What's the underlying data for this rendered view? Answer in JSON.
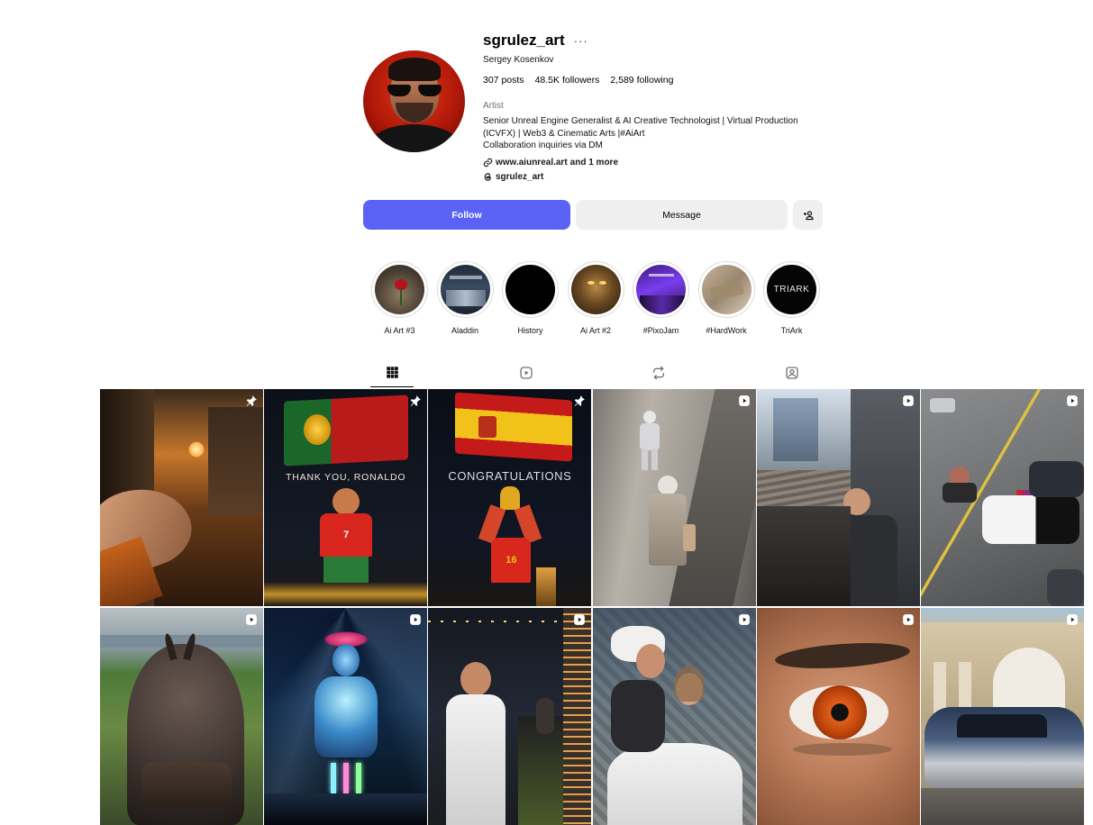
{
  "profile": {
    "username": "sgrulez_art",
    "more": "···",
    "full_name": "Sergey Kosenkov",
    "stats": {
      "posts": "307",
      "posts_label": "posts",
      "followers": "48.5K",
      "followers_label": "followers",
      "following": "2,589",
      "following_label": "following"
    },
    "category": "Artist",
    "bio_lines": [
      "Senior Unreal Engine Generalist & AI Creative Technologist | Virtual Production",
      "(ICVFX) | Web3 & Cinematic Arts |#AiArt",
      "Collaboration inquiries via DM"
    ],
    "link": "www.aiunreal.art",
    "link_more": "and 1 more",
    "threads_handle": "sgrulez_art"
  },
  "actions": {
    "follow": "Follow",
    "message": "Message"
  },
  "highlights": [
    {
      "label": "Ai Art #3"
    },
    {
      "label": "Aladdin"
    },
    {
      "label": "History"
    },
    {
      "label": "Ai Art #2"
    },
    {
      "label": "#PixoJam"
    },
    {
      "label": "#HardWork"
    },
    {
      "label": "TriArk"
    }
  ],
  "highlight_texts": {
    "triark": "TRIARK"
  },
  "tabs": [
    {
      "name": "posts",
      "icon": "grid-icon"
    },
    {
      "name": "reels",
      "icon": "reels-icon"
    },
    {
      "name": "reposts",
      "icon": "repost-icon"
    },
    {
      "name": "tagged",
      "icon": "tagged-icon"
    }
  ],
  "posts": [
    {
      "type": "pinned",
      "icon": "pin-icon"
    },
    {
      "type": "pinned",
      "icon": "pin-icon",
      "caption": "THANK YOU, RONALDO",
      "jersey": "7"
    },
    {
      "type": "pinned",
      "icon": "pin-icon",
      "caption": "CONGRATULATIONS",
      "jersey": "16"
    },
    {
      "type": "reel",
      "icon": "reel-icon"
    },
    {
      "type": "reel",
      "icon": "reel-icon"
    },
    {
      "type": "reel",
      "icon": "reel-icon"
    },
    {
      "type": "reel",
      "icon": "reel-icon"
    },
    {
      "type": "reel",
      "icon": "reel-icon"
    },
    {
      "type": "reel",
      "icon": "reel-icon"
    },
    {
      "type": "reel",
      "icon": "reel-icon"
    },
    {
      "type": "reel",
      "icon": "reel-icon"
    },
    {
      "type": "reel",
      "icon": "reel-icon"
    }
  ],
  "colors": {
    "follow_button": "#5b63f6",
    "secondary_button": "#efefef",
    "muted_text": "#737373"
  }
}
